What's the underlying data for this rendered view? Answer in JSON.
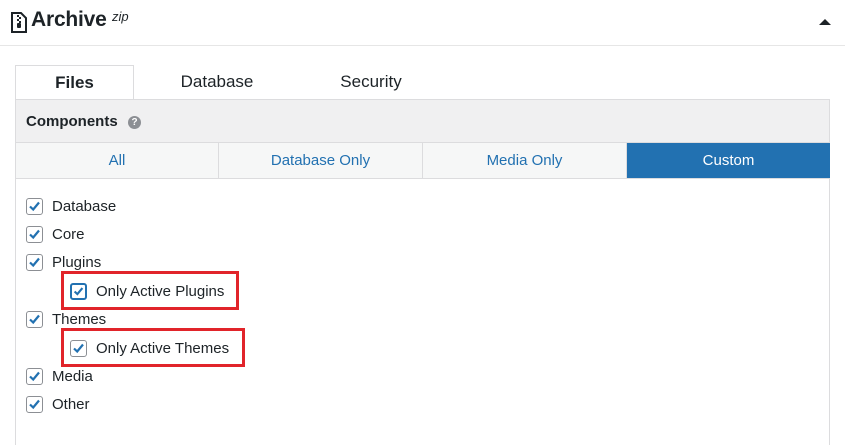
{
  "header": {
    "title": "Archive",
    "title_sup": "zip"
  },
  "tabs": [
    {
      "label": "Files",
      "active": true
    },
    {
      "label": "Database",
      "active": false
    },
    {
      "label": "Security",
      "active": false
    }
  ],
  "components": {
    "title": "Components",
    "help_glyph": "?"
  },
  "presets": [
    {
      "label": "All",
      "selected": false
    },
    {
      "label": "Database Only",
      "selected": false
    },
    {
      "label": "Media Only",
      "selected": false
    },
    {
      "label": "Custom",
      "selected": true
    }
  ],
  "checkboxes": [
    {
      "label": "Database",
      "checked": true
    },
    {
      "label": "Core",
      "checked": true
    },
    {
      "label": "Plugins",
      "checked": true
    },
    {
      "label": "Only Active Plugins",
      "checked": true
    },
    {
      "label": "Themes",
      "checked": true
    },
    {
      "label": "Only Active Themes",
      "checked": true
    },
    {
      "label": "Media",
      "checked": true
    },
    {
      "label": "Other",
      "checked": true
    }
  ],
  "colors": {
    "accent": "#2271b1",
    "highlight": "#e1242a"
  },
  "icons": {
    "archive": "zip-file-icon",
    "collapse": "caret-up-icon",
    "help": "question-circle-icon",
    "check": "checkmark-icon"
  }
}
